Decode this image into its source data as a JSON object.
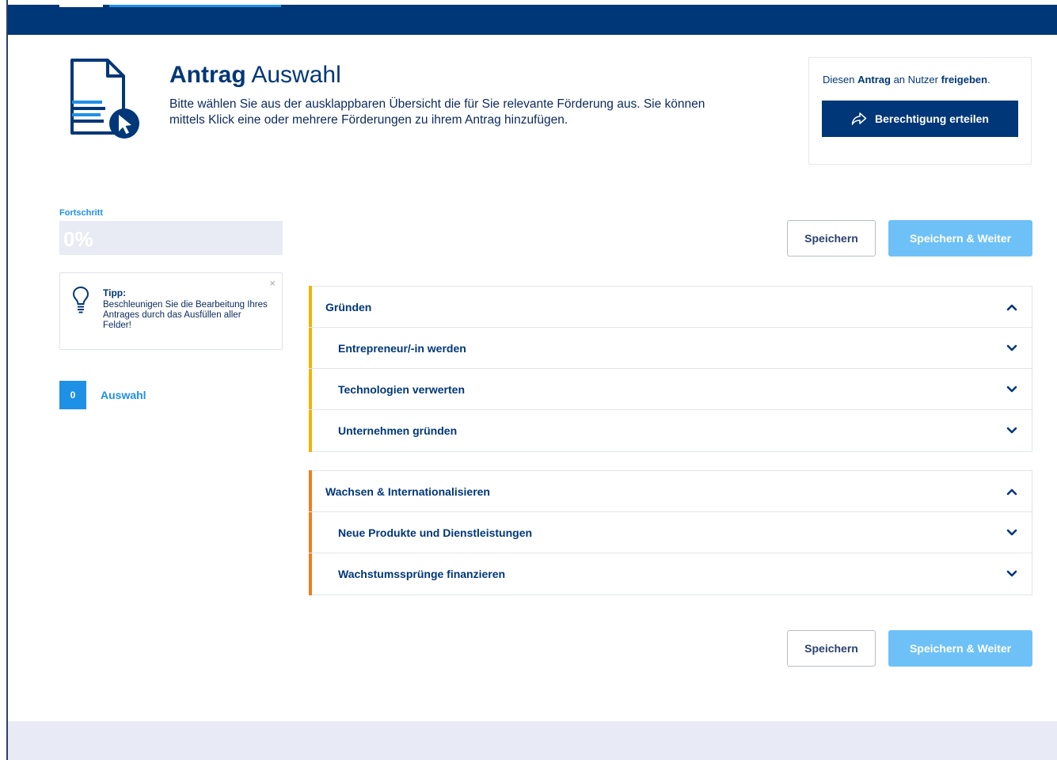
{
  "header": {
    "title_bold": "Antrag",
    "title_rest": "Auswahl",
    "description": "Bitte wählen Sie aus der ausklappbaren Übersicht die für Sie relevante Förderung aus. Sie können mittels Klick eine oder mehrere Förderungen zu ihrem Antrag hinzufügen."
  },
  "share": {
    "text_1": "Diesen ",
    "text_2": "Antrag",
    "text_3": " an Nutzer ",
    "text_4": "freigeben",
    "text_5": ".",
    "button_label": "Berechtigung erteilen",
    "button_icon": "share-arrow-icon"
  },
  "progress": {
    "label": "Fortschritt",
    "value_text": "0%",
    "value": 0
  },
  "tip": {
    "title": "Tipp:",
    "text": "Beschleunigen Sie die Bearbeitung Ihres Antrages durch das Ausfüllen aller Felder!",
    "close": "×",
    "icon": "lightbulb-icon"
  },
  "selection": {
    "count": "0",
    "label": "Auswahl"
  },
  "actions": {
    "save": "Speichern",
    "save_continue": "Speichern & Weiter"
  },
  "groups": [
    {
      "title": "Gründen",
      "color": "#f0b400",
      "items": [
        "Entrepreneur/-in werden",
        "Technologien verwerten",
        "Unternehmen gründen"
      ]
    },
    {
      "title": "Wachsen & Internationalisieren",
      "color": "#f07d1e",
      "items": [
        "Neue Produkte und Dienstleistungen",
        "Wachstumssprünge finanzieren"
      ]
    }
  ],
  "colors": {
    "primary": "#003778",
    "accent_blue": "#1e90e6",
    "light_button": "#6ec1f7"
  }
}
